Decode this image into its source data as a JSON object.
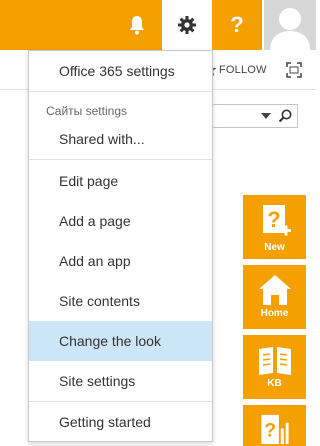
{
  "suite_bar": {
    "icons": {
      "bell": "bell-icon",
      "gear": "gear-icon",
      "help": "help-icon",
      "avatar": "avatar-icon"
    },
    "help_glyph": "?",
    "accent_color": "#f5a000"
  },
  "page": {
    "follow_label": "FOLLOW"
  },
  "settings_menu": {
    "office365_settings": "Office 365 settings",
    "section_header": "Сайты settings",
    "shared_with": "Shared with...",
    "items": [
      {
        "label": "Edit page"
      },
      {
        "label": "Add a page"
      },
      {
        "label": "Add an app"
      },
      {
        "label": "Site contents"
      },
      {
        "label": "Change the look"
      },
      {
        "label": "Site settings"
      },
      {
        "label": "Getting started"
      }
    ],
    "highlight_color": "#cde6f7"
  },
  "tiles": {
    "new": "New",
    "home": "Home",
    "kb": "KB"
  }
}
